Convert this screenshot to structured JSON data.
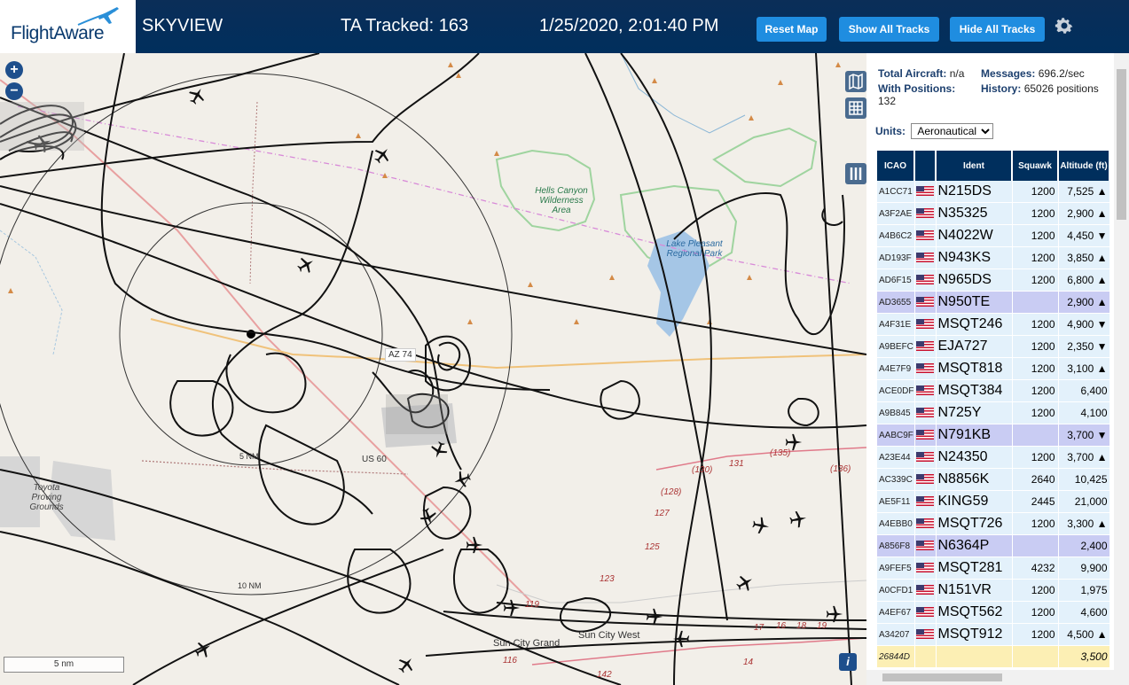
{
  "header": {
    "logo_text": "FlightAware",
    "app_name": "SKYVIEW",
    "tracked_label": "TA Tracked: 163",
    "datetime": "1/25/2020, 2:01:40 PM",
    "buttons": {
      "reset": "Reset Map",
      "show": "Show All Tracks",
      "hide": "Hide All Tracks"
    }
  },
  "map": {
    "labels": {
      "hells_canyon": "Hells Canyon Wilderness Area",
      "lake_pleasant": "Lake Pleasant Regional Park",
      "toyota": "Toyota Proving Grounds",
      "az74": "AZ 74",
      "us60": "US 60",
      "ring5": "5 NM",
      "ring10": "10 NM",
      "sun_city_grand": "Sun City Grand",
      "sun_city_west": "Sun City West",
      "r130": "(130)",
      "r131": "131",
      "r135": "(135)",
      "r136": "(136)",
      "r128": "(128)",
      "r127": "127",
      "r125": "125",
      "r123": "123",
      "r119": "119",
      "r116": "116",
      "r142": "142",
      "r17": "17",
      "r16": "16",
      "r18": "18",
      "r19": "19",
      "r14": "14"
    },
    "zoom_in": "+",
    "zoom_out": "−",
    "scale_label": "5 nm",
    "info": "i"
  },
  "sidebar": {
    "stats": {
      "total_aircraft_label": "Total Aircraft:",
      "total_aircraft_value": "n/a",
      "with_positions_label": "With Positions:",
      "with_positions_value": "132",
      "messages_label": "Messages:",
      "messages_value": "696.2/sec",
      "history_label": "History:",
      "history_value": "65026 positions"
    },
    "units_label": "Units:",
    "units_value": "Aeronautical",
    "columns": [
      "ICAO",
      "Ident",
      "Squawk",
      "Altitude (ft)"
    ],
    "rows": [
      {
        "icao": "A1CC71",
        "ident": "N215DS",
        "squawk": "1200",
        "alt": "7,525 ▲",
        "style": ""
      },
      {
        "icao": "A3F2AE",
        "ident": "N35325",
        "squawk": "1200",
        "alt": "2,900 ▲",
        "style": ""
      },
      {
        "icao": "A4B6C2",
        "ident": "N4022W",
        "squawk": "1200",
        "alt": "4,450 ▼",
        "style": ""
      },
      {
        "icao": "AD193F",
        "ident": "N943KS",
        "squawk": "1200",
        "alt": "3,850 ▲",
        "style": ""
      },
      {
        "icao": "AD6F15",
        "ident": "N965DS",
        "squawk": "1200",
        "alt": "6,800 ▲",
        "style": ""
      },
      {
        "icao": "AD3655",
        "ident": "N950TE",
        "squawk": "",
        "alt": "2,900 ▲",
        "style": "sel"
      },
      {
        "icao": "A4F31E",
        "ident": "MSQT246",
        "squawk": "1200",
        "alt": "4,900 ▼",
        "style": ""
      },
      {
        "icao": "A9BEFC",
        "ident": "EJA727",
        "squawk": "1200",
        "alt": "2,350 ▼",
        "style": ""
      },
      {
        "icao": "A4E7F9",
        "ident": "MSQT818",
        "squawk": "1200",
        "alt": "3,100 ▲",
        "style": ""
      },
      {
        "icao": "ACE0DF",
        "ident": "MSQT384",
        "squawk": "1200",
        "alt": "6,400",
        "style": ""
      },
      {
        "icao": "A9B845",
        "ident": "N725Y",
        "squawk": "1200",
        "alt": "4,100",
        "style": ""
      },
      {
        "icao": "AABC9F",
        "ident": "N791KB",
        "squawk": "",
        "alt": "3,700 ▼",
        "style": "sel"
      },
      {
        "icao": "A23E44",
        "ident": "N24350",
        "squawk": "1200",
        "alt": "3,700 ▲",
        "style": ""
      },
      {
        "icao": "AC339C",
        "ident": "N8856K",
        "squawk": "2640",
        "alt": "10,425",
        "style": ""
      },
      {
        "icao": "AE5F11",
        "ident": "KING59",
        "squawk": "2445",
        "alt": "21,000",
        "style": ""
      },
      {
        "icao": "A4EBB0",
        "ident": "MSQT726",
        "squawk": "1200",
        "alt": "3,300 ▲",
        "style": ""
      },
      {
        "icao": "A856F8",
        "ident": "N6364P",
        "squawk": "",
        "alt": "2,400",
        "style": "sel"
      },
      {
        "icao": "A9FEF5",
        "ident": "MSQT281",
        "squawk": "4232",
        "alt": "9,900",
        "style": ""
      },
      {
        "icao": "A0CFD1",
        "ident": "N151VR",
        "squawk": "1200",
        "alt": "1,975",
        "style": ""
      },
      {
        "icao": "A4EF67",
        "ident": "MSQT562",
        "squawk": "1200",
        "alt": "4,600",
        "style": ""
      },
      {
        "icao": "A34207",
        "ident": "MSQT912",
        "squawk": "1200",
        "alt": "4,500 ▲",
        "style": ""
      },
      {
        "icao": "26844D",
        "ident": "",
        "squawk": "",
        "alt": "3,500",
        "style": "yellow"
      }
    ]
  },
  "icons": {
    "gear": "gear-icon",
    "map_layers": "map-icon",
    "grid": "grid-icon",
    "columns": "columns-icon",
    "aircraft": "aircraft-icon"
  },
  "colors": {
    "header_bg": "#002f5d",
    "button_bg": "#1f8de0",
    "row_bg": "#e3f1fb",
    "row_selected": "#c9ccf3",
    "row_yellow": "#fcefb4"
  }
}
